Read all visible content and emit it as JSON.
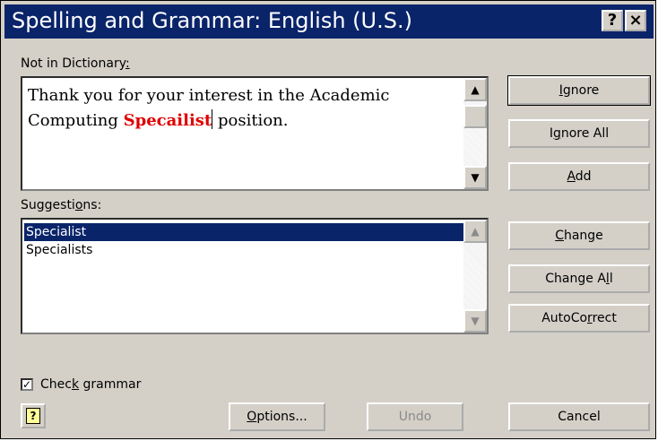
{
  "window": {
    "title": "Spelling and Grammar: English (U.S.)"
  },
  "titlebar_buttons": {
    "help": "?",
    "close": "×"
  },
  "not_in_dictionary": {
    "label_pre": "Not in Dictionary",
    "label_key": ":",
    "text_before": "Thank you for your interest in the Academic Computing ",
    "error_word": "Specailist",
    "text_after": " position."
  },
  "suggestions": {
    "label_pre": "Suggesti",
    "label_key": "o",
    "label_post": "ns:",
    "items": [
      "Specialist",
      "Specialists"
    ],
    "selected_index": 0
  },
  "buttons": {
    "ignore": {
      "key": "I",
      "post": "gnore"
    },
    "ignore_all": {
      "pre": "I",
      "key": "g",
      "post": "nore All"
    },
    "add": {
      "key": "A",
      "post": "dd"
    },
    "change": {
      "key": "C",
      "post": "hange"
    },
    "change_all": {
      "pre": "Change A",
      "key": "l",
      "post": "l"
    },
    "autocorrect": {
      "pre": "AutoCo",
      "key": "r",
      "post": "rect"
    },
    "options": {
      "key": "O",
      "post": "ptions..."
    },
    "undo": "Undo",
    "cancel": "Cancel"
  },
  "check_grammar": {
    "pre": "Chec",
    "key": "k",
    "post": " grammar",
    "checked": true,
    "mark": "✓"
  },
  "help_icon_glyph": "?"
}
